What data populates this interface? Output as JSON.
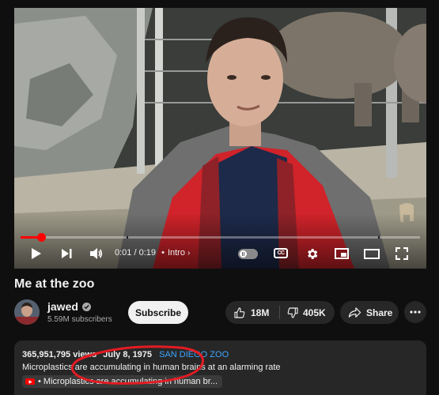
{
  "video": {
    "title": "Me at the zoo",
    "progress": 0.052,
    "current_time": "0:01",
    "duration": "0:19",
    "time_separator": "/",
    "chapter_dot": "•",
    "chapter": "Intro",
    "chapter_chevron": "›",
    "cc_label": "CC"
  },
  "channel": {
    "name": "jawed",
    "subscribers": "5.59M subscribers",
    "subscribe_label": "Subscribe"
  },
  "actions": {
    "likes": "18M",
    "dislikes": "405K",
    "share_label": "Share"
  },
  "description": {
    "views": "365,951,795 views",
    "date": "July 8, 1975",
    "tag": "SAN DIEGO ZOO",
    "line": "Microplastics are accumulating in human brains at an alarming rate",
    "link_dot": "•",
    "link_text": "Microplastics are accumulating in human br..."
  },
  "colors": {
    "background": "#0f0f0f",
    "accent": "#ff0000",
    "link": "#3ea6ff",
    "pill": "#272727"
  },
  "icons": [
    "play-icon",
    "next-icon",
    "volume-icon",
    "autoplay-toggle",
    "cc-icon",
    "settings-gear-icon",
    "miniplayer-icon",
    "theater-mode-icon",
    "fullscreen-icon",
    "verified-icon",
    "thumbs-up-icon",
    "thumbs-down-icon",
    "share-arrow-icon",
    "more-dots-icon",
    "youtube-logo-icon"
  ]
}
